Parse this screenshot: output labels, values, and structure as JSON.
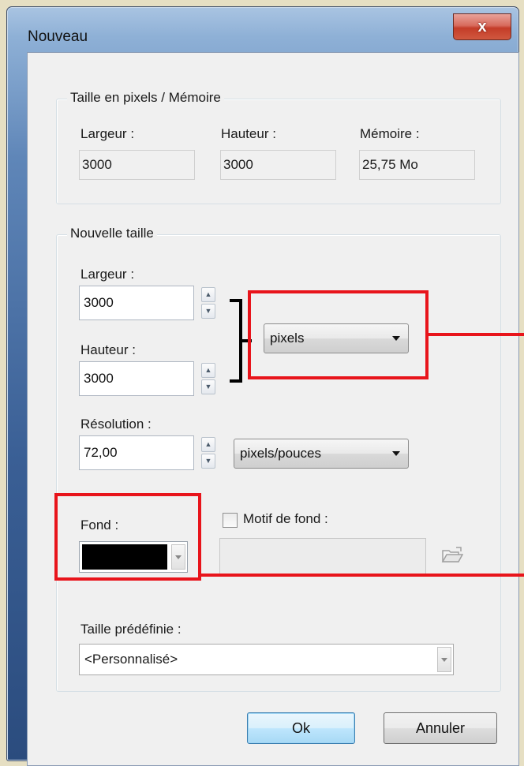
{
  "window": {
    "title": "Nouveau",
    "close_label": "x"
  },
  "memory_group": {
    "title": "Taille en pixels / Mémoire",
    "width_label": "Largeur :",
    "width_value": "3000",
    "height_label": "Hauteur :",
    "height_value": "3000",
    "memory_label": "Mémoire :",
    "memory_value": "25,75 Mo"
  },
  "size_group": {
    "title": "Nouvelle taille",
    "width_label": "Largeur :",
    "width_value": "3000",
    "height_label": "Hauteur :",
    "height_value": "3000",
    "unit_value": "pixels",
    "resolution_label": "Résolution :",
    "resolution_value": "72,00",
    "resolution_unit_value": "pixels/pouces",
    "background_label": "Fond :",
    "background_color": "#000000",
    "pattern_checkbox_label": "Motif de fond :",
    "pattern_checked": false,
    "pattern_value": "",
    "preset_label": "Taille prédéfinie :",
    "preset_value": "<Personnalisé>"
  },
  "buttons": {
    "ok_label": "Ok",
    "cancel_label": "Annuler"
  },
  "colors": {
    "highlight": "#e8141b",
    "title_bar": "#5f86b8"
  }
}
